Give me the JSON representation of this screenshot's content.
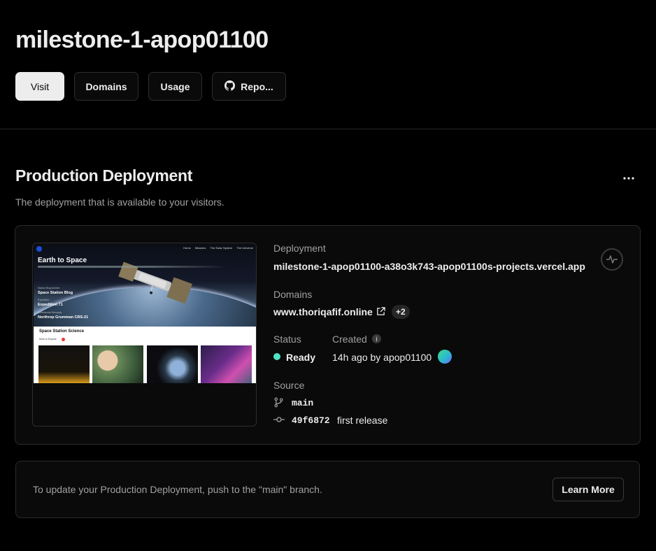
{
  "header": {
    "project_name": "milestone-1-apop01100",
    "buttons": {
      "visit": "Visit",
      "domains": "Domains",
      "usage": "Usage",
      "repo": "Repo..."
    }
  },
  "section": {
    "title": "Production Deployment",
    "subtitle": "The deployment that is available to your visitors.",
    "more_icon": "ellipsis-icon"
  },
  "preview": {
    "site_title": "Earth to Space",
    "nav": [
      "Home",
      "Missions",
      "The Solar System",
      "The Universe"
    ],
    "links": [
      {
        "kicker": "Station Blog Archive",
        "title": "Space Station Blog"
      },
      {
        "kicker": "Expedition",
        "title": "Expedition 71"
      },
      {
        "kicker": "Commercial Resupply",
        "title": "Northrop Grumman CRS-21"
      }
    ],
    "science_heading": "Space Station Science",
    "science_sub": "More to Explore"
  },
  "deployment": {
    "label": "Deployment",
    "url": "milestone-1-apop01100-a38o3k743-apop01100s-projects.vercel.app",
    "activity_icon": "activity-pulse-icon"
  },
  "domains": {
    "label": "Domains",
    "primary": "www.thoriqafif.online",
    "extra_count": "+2"
  },
  "status": {
    "label": "Status",
    "value": "Ready",
    "color": "#4fe3c1"
  },
  "created": {
    "label": "Created",
    "value": "14h ago by apop01100",
    "info": "i"
  },
  "source": {
    "label": "Source",
    "branch": "main",
    "commit_hash": "49f6872",
    "commit_message": "first release"
  },
  "notice": {
    "text": "To update your Production Deployment, push to the \"main\" branch.",
    "button": "Learn More"
  }
}
